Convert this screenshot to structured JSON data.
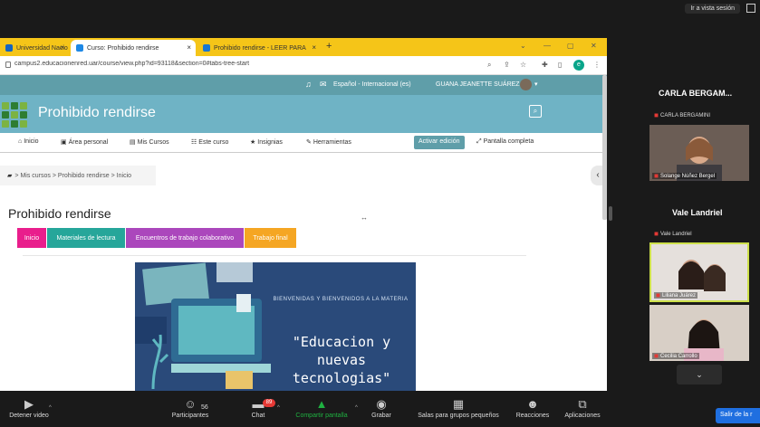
{
  "zoom": {
    "view_button": "Ir a vista sesión",
    "toolbar": {
      "video": "Detener video",
      "participants": "Participantes",
      "participants_count": "56",
      "chat": "Chat",
      "chat_badge": "89",
      "share": "Compartir pantalla",
      "record": "Grabar",
      "breakout": "Salas para grupos pequeños",
      "reactions": "Reacciones",
      "apps": "Aplicaciones",
      "leave": "Salir de la r"
    },
    "participants": [
      {
        "tile_name": "CARLA BERGAM...",
        "sub": "CARLA BERGAMINI"
      },
      {
        "video_label": "Solange Núñez Bergel"
      },
      {
        "tile_name": "Vale Landriel",
        "sub": "Vale Landriel"
      },
      {
        "video_label": "Liliana Juárez"
      },
      {
        "video_label": "Cecilia Carrollo"
      }
    ],
    "scroll_down": "⌄"
  },
  "browser": {
    "tabs": [
      {
        "label": "Universidad Nacio",
        "color": "#1565c0"
      },
      {
        "label": "Curso: Prohibido rendirse",
        "color": "#1e88e5"
      },
      {
        "label": "Prohibido rendirse - LEER PARA",
        "color": "#1976d2"
      }
    ],
    "url": "campus2.educacionenred.uar/course/view.php?id=93118&section=0#tabs-tree-start",
    "profile_initial": "e"
  },
  "moodle": {
    "language": "Español - Internacional (es)",
    "user": "GUANA JEANETTE SUÁREZ",
    "site_title": "Prohibido rendirse",
    "nav": [
      {
        "icon": "⌂",
        "label": "Inicio"
      },
      {
        "icon": "▣",
        "label": "Área personal"
      },
      {
        "icon": "▤",
        "label": "Mis Cursos"
      },
      {
        "icon": "☷",
        "label": "Este curso"
      },
      {
        "icon": "★",
        "label": "Insignias"
      },
      {
        "icon": "✎",
        "label": "Herramientas"
      }
    ],
    "activate_edit": "Activar edición",
    "fullscreen": "Pantalla completa",
    "breadcrumb": [
      "Mis cursos",
      "Prohibido rendirse",
      "Inicio"
    ],
    "page_title": "Prohibido rendirse",
    "course_tabs": [
      {
        "label": "Inicio",
        "color": "#e91e8c"
      },
      {
        "label": "Materiales de lectura",
        "color": "#26a69a"
      },
      {
        "label": "Encuentros de trabajo colaborativo",
        "color": "#ab47bc"
      },
      {
        "label": "Trabajo final",
        "color": "#f5a623"
      }
    ],
    "hero_small": "BIENVENIDAS Y BIENVENIDOS A LA MATERIA",
    "hero_big": "\"Educacion y nuevas tecnologias\""
  },
  "colors": {
    "topbar": "#5f9ea9",
    "banner": "#6fb3c5",
    "hero_bg": "#2a4a7a",
    "zoom_share": "#1fb141",
    "leave_btn": "#1f6fe0"
  }
}
